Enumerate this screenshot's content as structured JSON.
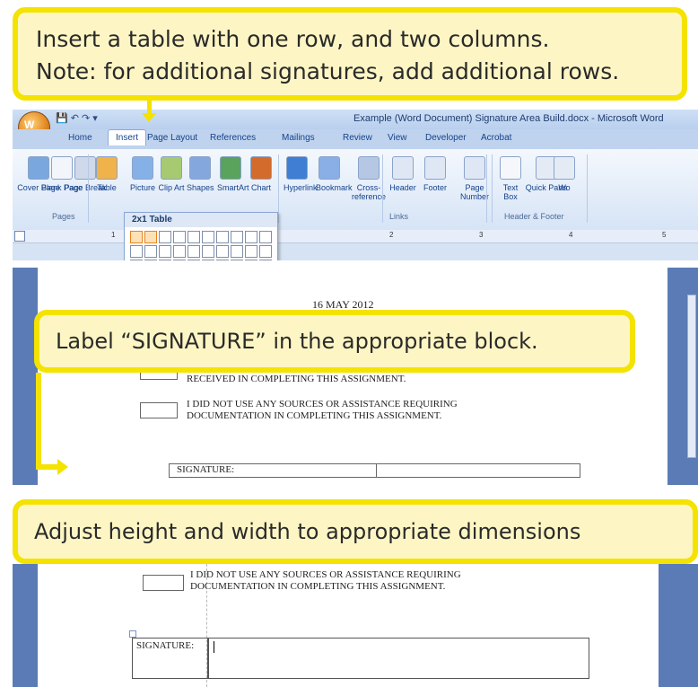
{
  "callouts": {
    "top": [
      "Insert a table with one row, and two columns.",
      "Note: for additional signatures, add additional rows."
    ],
    "middle": "Label “SIGNATURE” in the appropriate block.",
    "bottom": "Adjust height and width to appropriate dimensions"
  },
  "word": {
    "title": "Example (Word Document) Signature Area Build.docx - Microsoft Word",
    "office_button_label": "W",
    "tabs": [
      "Home",
      "Insert",
      "Page Layout",
      "References",
      "Mailings",
      "Review",
      "View",
      "Developer",
      "Acrobat"
    ],
    "active_tab": "Insert",
    "ribbon_buttons": [
      {
        "label": "Cover Page",
        "icon": "cover-page-icon",
        "color": "#7aa7dd"
      },
      {
        "label": "Blank Page",
        "icon": "blank-page-icon",
        "color": "#f2f5fa"
      },
      {
        "label": "Page Break",
        "icon": "page-break-icon",
        "color": "#cfd9ea"
      },
      {
        "label": "Table",
        "icon": "table-icon",
        "color": "#f0b24b"
      },
      {
        "label": "Picture",
        "icon": "picture-icon",
        "color": "#86b1e6"
      },
      {
        "label": "Clip Art",
        "icon": "clip-art-icon",
        "color": "#a7c972"
      },
      {
        "label": "Shapes",
        "icon": "shapes-icon",
        "color": "#84a8de"
      },
      {
        "label": "SmartArt",
        "icon": "smartart-icon",
        "color": "#5aa35d"
      },
      {
        "label": "Chart",
        "icon": "chart-icon",
        "color": "#d26b2c"
      },
      {
        "label": "Hyperlink",
        "icon": "hyperlink-icon",
        "color": "#3f7ed2"
      },
      {
        "label": "Bookmark",
        "icon": "bookmark-icon",
        "color": "#8aaee6"
      },
      {
        "label": "Cross-reference",
        "icon": "cross-reference-icon",
        "color": "#b6c7e3"
      },
      {
        "label": "Header",
        "icon": "header-icon",
        "color": "#dfe7f4"
      },
      {
        "label": "Footer",
        "icon": "footer-icon",
        "color": "#dfe7f4"
      },
      {
        "label": "Page Number",
        "icon": "page-number-icon",
        "color": "#dfe7f4"
      },
      {
        "label": "Text Box",
        "icon": "text-box-icon",
        "color": "#f5f7fb"
      },
      {
        "label": "Quick Parts",
        "icon": "quick-parts-icon",
        "color": "#e5ebf5"
      },
      {
        "label": "Wo",
        "icon": "wordart-icon",
        "color": "#e5ebf5"
      }
    ],
    "groups": [
      "Pages",
      "Links",
      "Header & Footer"
    ],
    "table_dropdown_header": "2x1 Table",
    "table_dropdown_selected": {
      "rows": 1,
      "cols": 2
    },
    "ruler_numbers": [
      "1",
      "2",
      "3",
      "4",
      "5"
    ]
  },
  "doc2": {
    "date": "16 MAY 2012",
    "line_received": "RECEIVED IN COMPLETING THIS ASSIGNMENT.",
    "line_no_sources_1": "I DID NOT USE ANY SOURCES OR ASSISTANCE REQUIRING",
    "line_no_sources_2": "DOCUMENTATION IN COMPLETING THIS ASSIGNMENT.",
    "signature_label": "SIGNATURE:"
  },
  "doc3": {
    "line_no_sources_1": "I DID NOT USE ANY SOURCES OR ASSISTANCE REQUIRING",
    "line_no_sources_2": "DOCUMENTATION IN COMPLETING THIS ASSIGNMENT.",
    "signature_label": "SIGNATURE:"
  },
  "colors": {
    "callout_border": "#f4e200",
    "callout_fill": "#fdf6c4",
    "document_side": "#5b7bb6"
  }
}
